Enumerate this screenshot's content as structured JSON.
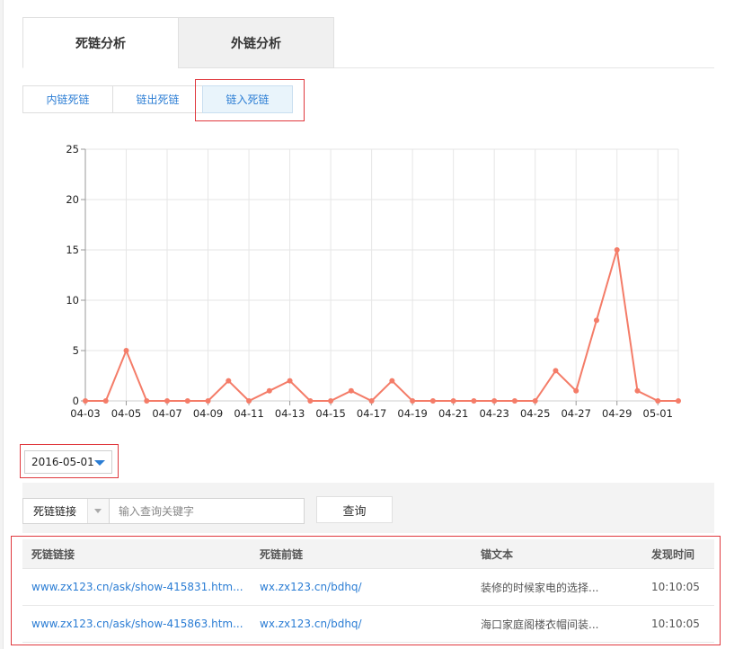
{
  "main_tabs": [
    {
      "label": "死链分析",
      "active": true
    },
    {
      "label": "外链分析",
      "active": false
    }
  ],
  "sub_tabs": [
    {
      "label": "内链死链"
    },
    {
      "label": "链出死链"
    },
    {
      "label": "链入死链",
      "active": true
    }
  ],
  "chart_data": {
    "type": "line",
    "x": [
      "04-03",
      "04-04",
      "04-05",
      "04-06",
      "04-07",
      "04-08",
      "04-09",
      "04-10",
      "04-11",
      "04-12",
      "04-13",
      "04-14",
      "04-15",
      "04-16",
      "04-17",
      "04-18",
      "04-19",
      "04-20",
      "04-21",
      "04-22",
      "04-23",
      "04-24",
      "04-25",
      "04-26",
      "04-27",
      "04-28",
      "04-29",
      "04-30",
      "05-01",
      "05-02"
    ],
    "x_tick_labels": [
      "04-03",
      "04-05",
      "04-07",
      "04-09",
      "04-11",
      "04-13",
      "04-15",
      "04-17",
      "04-19",
      "04-21",
      "04-23",
      "04-25",
      "04-27",
      "04-29",
      "05-01"
    ],
    "series": [
      {
        "values": [
          0,
          0,
          5,
          0,
          0,
          0,
          0,
          2,
          0,
          1,
          2,
          0,
          0,
          1,
          0,
          2,
          0,
          0,
          0,
          0,
          0,
          0,
          0,
          3,
          1,
          8,
          15,
          1,
          0,
          0
        ]
      }
    ],
    "ylim": [
      0,
      25
    ],
    "y_ticks": [
      0,
      5,
      10,
      15,
      20,
      25
    ],
    "grid": true,
    "line_color": "#f47c68",
    "grid_color": "#e6e6e6"
  },
  "date_picker": {
    "value": "2016-05-01"
  },
  "search": {
    "select_value": "死链链接",
    "placeholder": "输入查询关键字",
    "button_label": "查询"
  },
  "table": {
    "headers": [
      "死链链接",
      "死链前链",
      "锚文本",
      "发现时间"
    ],
    "rows": [
      [
        "www.zx123.cn/ask/show-415831.htm...",
        "wx.zx123.cn/bdhq/",
        "装修的时候家电的选择...",
        "10:10:05"
      ],
      [
        "www.zx123.cn/ask/show-415863.htm...",
        "wx.zx123.cn/bdhq/",
        "海口家庭阁楼衣帽间装...",
        "10:10:05"
      ]
    ]
  },
  "colors": {
    "accent": "#2b7dd4",
    "highlight": "#e0393e"
  }
}
